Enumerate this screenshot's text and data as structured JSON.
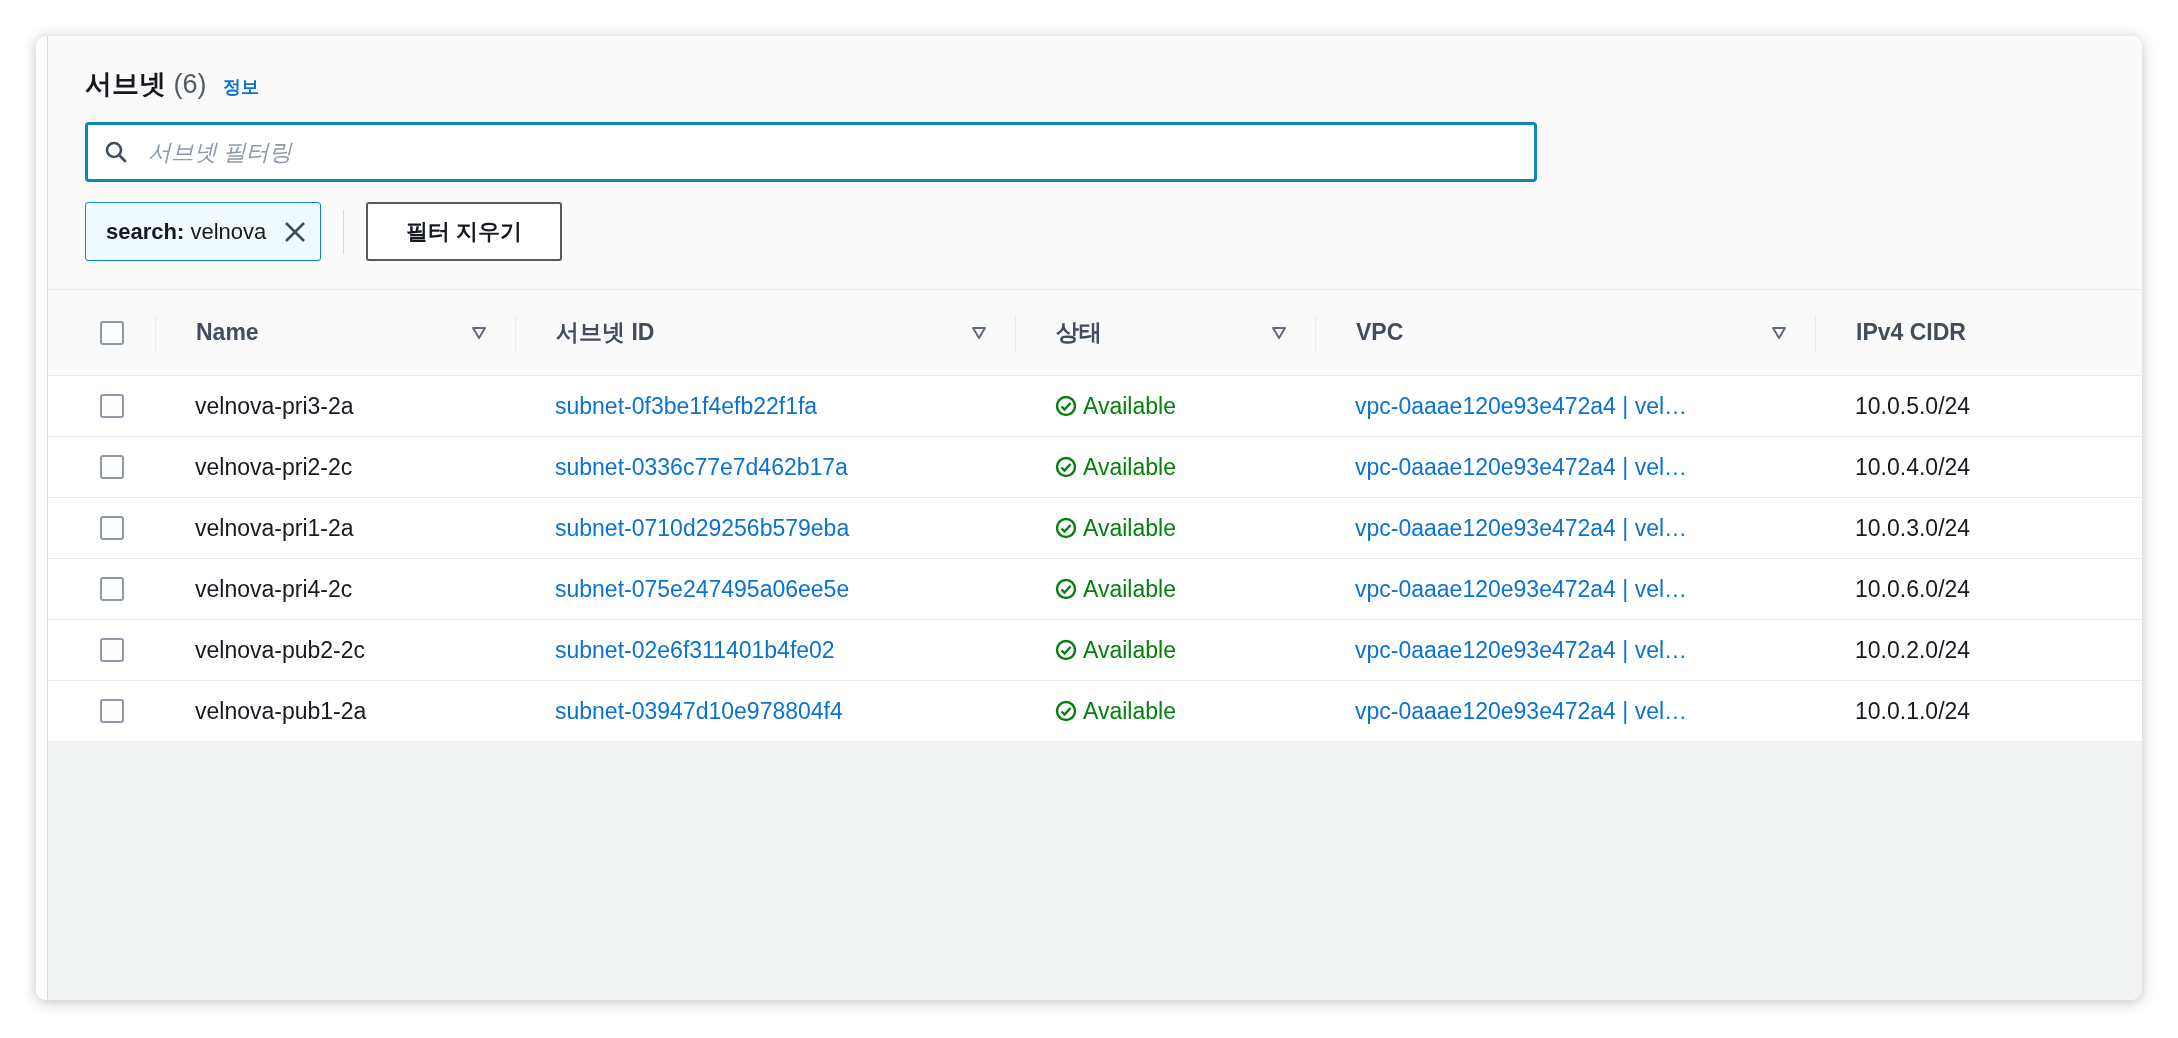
{
  "header": {
    "title": "서브넷",
    "count": "(6)",
    "info_link": "정보"
  },
  "filter": {
    "placeholder": "서브넷 필터링",
    "tokens": [
      {
        "key": "search:",
        "value": "velnova"
      }
    ],
    "clear_button": "필터 지우기"
  },
  "table": {
    "select_all": {
      "checked": false
    },
    "columns": [
      {
        "label": "Name",
        "sortable": true
      },
      {
        "label": "서브넷 ID",
        "sortable": true
      },
      {
        "label": "상태",
        "sortable": true
      },
      {
        "label": "VPC",
        "sortable": true
      },
      {
        "label": "IPv4 CIDR",
        "sortable": false
      }
    ],
    "rows": [
      {
        "selected": false,
        "name": "velnova-pri3-2a",
        "subnet_id": "subnet-0f3be1f4efb22f1fa",
        "status": "Available",
        "vpc": "vpc-0aaae120e93e472a4 | vel…",
        "cidr": "10.0.5.0/24"
      },
      {
        "selected": false,
        "name": "velnova-pri2-2c",
        "subnet_id": "subnet-0336c77e7d462b17a",
        "status": "Available",
        "vpc": "vpc-0aaae120e93e472a4 | vel…",
        "cidr": "10.0.4.0/24"
      },
      {
        "selected": false,
        "name": "velnova-pri1-2a",
        "subnet_id": "subnet-0710d29256b579eba",
        "status": "Available",
        "vpc": "vpc-0aaae120e93e472a4 | vel…",
        "cidr": "10.0.3.0/24"
      },
      {
        "selected": false,
        "name": "velnova-pri4-2c",
        "subnet_id": "subnet-075e247495a06ee5e",
        "status": "Available",
        "vpc": "vpc-0aaae120e93e472a4 | vel…",
        "cidr": "10.0.6.0/24"
      },
      {
        "selected": false,
        "name": "velnova-pub2-2c",
        "subnet_id": "subnet-02e6f311401b4fe02",
        "status": "Available",
        "vpc": "vpc-0aaae120e93e472a4 | vel…",
        "cidr": "10.0.2.0/24"
      },
      {
        "selected": false,
        "name": "velnova-pub1-2a",
        "subnet_id": "subnet-03947d10e978804f4",
        "status": "Available",
        "vpc": "vpc-0aaae120e93e472a4 | vel…",
        "cidr": "10.0.1.0/24"
      }
    ]
  }
}
